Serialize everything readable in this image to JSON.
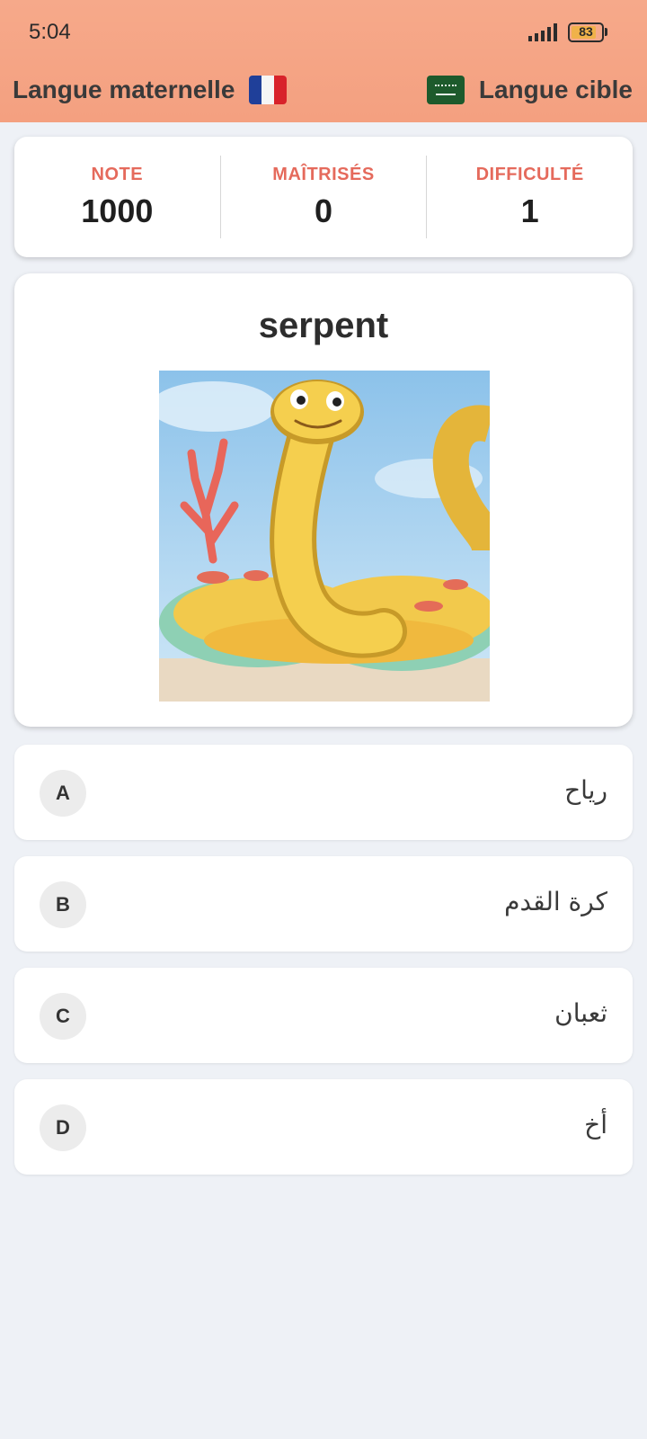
{
  "status_bar": {
    "time": "5:04",
    "battery": "83",
    "battery_level": 0.83
  },
  "header": {
    "native_language_label": "Langue maternelle",
    "native_flag_icon": "france-flag-icon",
    "target_language_label": "Langue cible",
    "target_flag_icon": "saudi-arabia-flag-icon",
    "background_color": "#f6a98a"
  },
  "stats": [
    {
      "label": "NOTE",
      "value": "1000"
    },
    {
      "label": "MAÎTRISÉS",
      "value": "0"
    },
    {
      "label": "DIFFICULTÉ",
      "value": "1"
    }
  ],
  "quiz": {
    "word": "serpent",
    "image": "cartoon-yellow-snake-illustration",
    "options": [
      {
        "letter": "A",
        "text": "رياح"
      },
      {
        "letter": "B",
        "text": "كرة القدم"
      },
      {
        "letter": "C",
        "text": "ثعبان"
      },
      {
        "letter": "D",
        "text": "أخ"
      }
    ]
  },
  "colors": {
    "accent": "#e56a5c",
    "page_background": "#eef1f6"
  }
}
